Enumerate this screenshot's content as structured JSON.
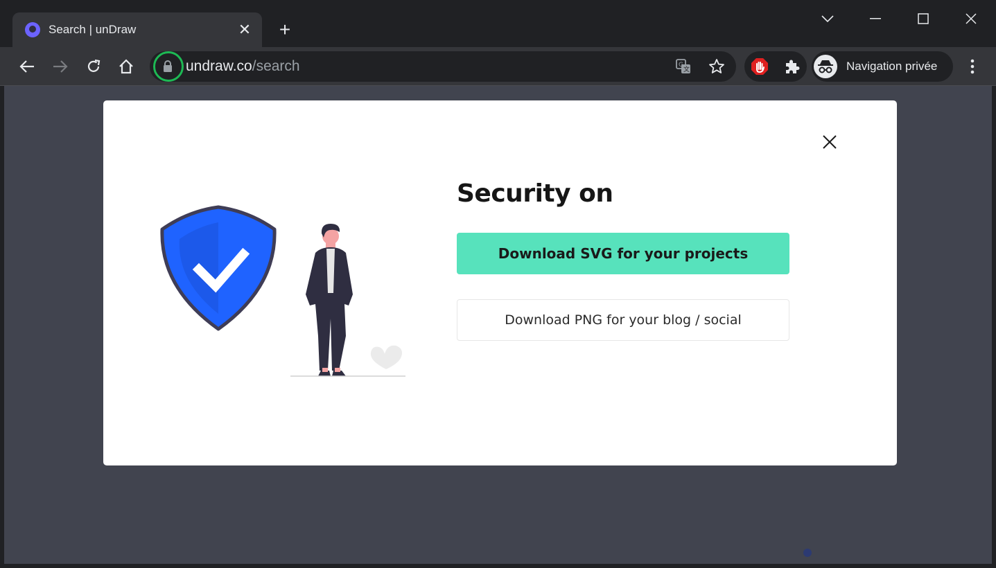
{
  "browser": {
    "tab": {
      "title": "Search | unDraw",
      "close_label": "✕"
    },
    "new_tab_label": "+",
    "omnibox": {
      "domain": "undraw.co",
      "path": "/search"
    },
    "profile_label": "Navigation privée"
  },
  "modal": {
    "title": "Security on",
    "primary_button": "Download SVG for your projects",
    "secondary_button": "Download PNG for your blog / social"
  },
  "colors": {
    "accent": "#57e2bc",
    "shield": "#1f63ff",
    "highlight_ring": "#1db954"
  }
}
